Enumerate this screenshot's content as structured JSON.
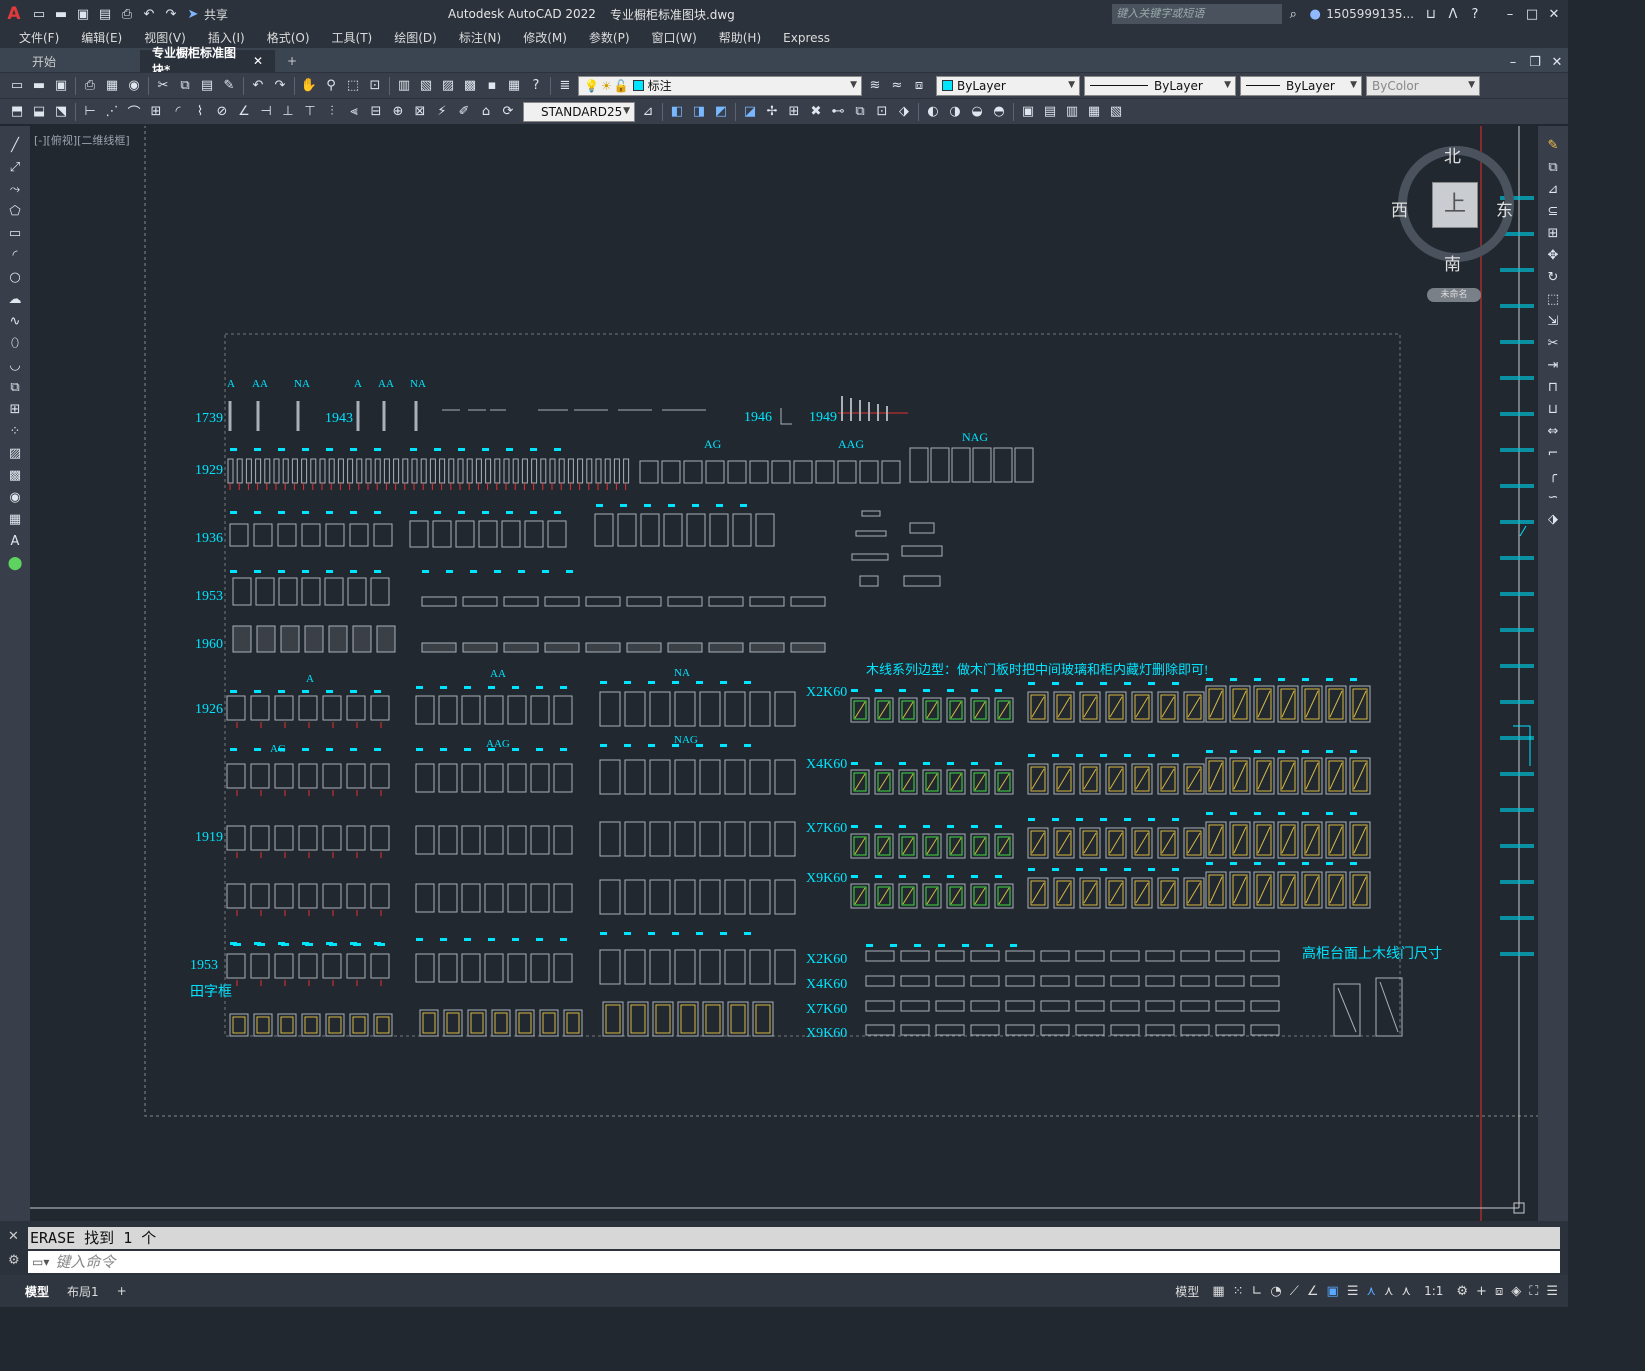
{
  "titlebar": {
    "app_title": "Autodesk AutoCAD 2022",
    "file_name": "专业橱柜标准图块.dwg",
    "search_placeholder": "键入关键字或短语",
    "user": "1505999135...",
    "share_label": "共享"
  },
  "menu": [
    "文件(F)",
    "编辑(E)",
    "视图(V)",
    "插入(I)",
    "格式(O)",
    "工具(T)",
    "绘图(D)",
    "标注(N)",
    "修改(M)",
    "参数(P)",
    "窗口(W)",
    "帮助(H)",
    "Express"
  ],
  "tabs": {
    "start": "开始",
    "active": "专业橱柜标准图块*"
  },
  "properties": {
    "layer": "标注",
    "color": "ByLayer",
    "linetype": "ByLayer",
    "lineweight": "ByLayer",
    "plotstyle": "ByColor",
    "dimstyle": "STANDARD25"
  },
  "viewport_label": "[-][俯视][二维线框]",
  "viewcube": {
    "north": "北",
    "south": "南",
    "west": "西",
    "east": "东",
    "top": "上",
    "ucs": "未命名"
  },
  "drawing": {
    "row_labels": [
      "1739",
      "1943",
      "1946",
      "1949",
      "1929",
      "1936",
      "1953",
      "1960",
      "1926",
      "1919",
      "1953"
    ],
    "tian_label": "田字框",
    "series_top": [
      "A",
      "AA",
      "NA",
      "A",
      "AA",
      "NA"
    ],
    "groups": [
      "AG",
      "AAG",
      "NAG"
    ],
    "groups2": [
      "A",
      "AA",
      "NA",
      "AG",
      "AAG",
      "NAG"
    ],
    "x_labels": [
      "X2K60",
      "X4K60",
      "X7K60",
      "X9K60"
    ],
    "wood_note": "木线系列边型：做木门板时把中间玻璃和柜内藏灯删除即可!",
    "tall_note": "高柜台面上木线门尺寸"
  },
  "command": {
    "history": "ERASE 找到 1 个",
    "placeholder": "键入命令"
  },
  "status": {
    "model_tab": "模型",
    "layout_tab": "布局1",
    "model": "模型",
    "scale": "1:1"
  }
}
